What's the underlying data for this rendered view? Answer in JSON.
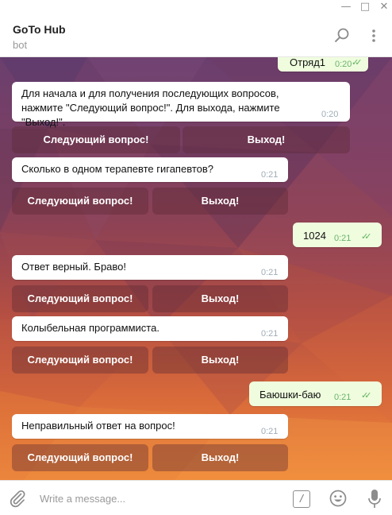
{
  "window": {
    "min_icon": "minimize-icon",
    "max_icon": "maximize-icon",
    "close_icon": "close-icon"
  },
  "header": {
    "title": "GoTo Hub",
    "subtitle": "bot",
    "search_icon": "search-icon",
    "more_icon": "more-vertical-icon"
  },
  "messages": [
    {
      "type": "out",
      "text": "Отряд1",
      "time": "0:20"
    },
    {
      "type": "in",
      "text": "Для начала и для получения последующих вопросов, нажмите \"Следующий вопрос!\". Для выхода, нажмите \"Выход!\".",
      "time": "0:20"
    },
    {
      "type": "keyboard",
      "buttons": [
        "Следующий вопрос!",
        "Выход!"
      ]
    },
    {
      "type": "in",
      "text": "Сколько в одном терапевте гигапевтов?",
      "time": "0:21"
    },
    {
      "type": "keyboard",
      "buttons": [
        "Следующий вопрос!",
        "Выход!"
      ]
    },
    {
      "type": "out",
      "text": "1024",
      "time": "0:21"
    },
    {
      "type": "in",
      "text": "Ответ верный. Браво!",
      "time": "0:21"
    },
    {
      "type": "keyboard",
      "buttons": [
        "Следующий вопрос!",
        "Выход!"
      ]
    },
    {
      "type": "in",
      "text": "Колыбельная программиста.",
      "time": "0:21"
    },
    {
      "type": "keyboard",
      "buttons": [
        "Следующий вопрос!",
        "Выход!"
      ]
    },
    {
      "type": "out",
      "text": "Баюшки-баю",
      "time": "0:21"
    },
    {
      "type": "in",
      "text": "Неправильный ответ на вопрос!",
      "time": "0:21"
    },
    {
      "type": "keyboard",
      "buttons": [
        "Следующий вопрос!",
        "Выход!"
      ]
    }
  ],
  "input": {
    "placeholder": "Write a message...",
    "command_label": "/"
  },
  "colors": {
    "accent_check": "#5fb35f",
    "outgoing_bubble": "#effdde",
    "incoming_bubble": "#ffffff"
  }
}
